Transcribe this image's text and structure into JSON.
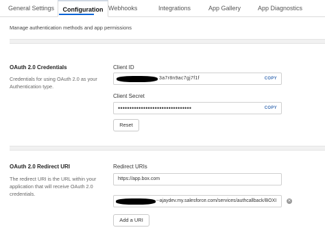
{
  "tabs": [
    {
      "label": "General Settings",
      "active": false
    },
    {
      "label": "Configuration",
      "active": true
    },
    {
      "label": "Webhooks",
      "active": false
    },
    {
      "label": "Integrations",
      "active": false
    },
    {
      "label": "App Gallery",
      "active": false
    },
    {
      "label": "App Diagnostics",
      "active": false
    }
  ],
  "colors": {
    "accent": "#0061d5",
    "copy_link": "#3d6fb4"
  },
  "subtitle": "Manage authentication methods and app permissions",
  "credentials": {
    "title": "OAuth 2.0 Credentials",
    "description": "Credentials for using OAuth 2.0 as your Authentication type.",
    "client_id": {
      "label": "Client ID",
      "value": "3a7r8n9ac7gj7f1f",
      "copy_label": "COPY"
    },
    "client_secret": {
      "label": "Client Secret",
      "value": "••••••••••••••••••••••••••••••••",
      "copy_label": "COPY"
    },
    "reset_label": "Reset"
  },
  "redirect": {
    "title": "OAuth 2.0 Redirect URI",
    "description": "The redirect URI is the URL within your application that will receive OAuth 2.0 credentials.",
    "label": "Redirect URIs",
    "uris": [
      {
        "value": "https://app.box.com"
      },
      {
        "value": "--ajaydev.my.salesforce.com/services/authcallback/BOXI"
      }
    ],
    "remove_icon": "x-circle-icon",
    "add_label": "Add a URI"
  }
}
